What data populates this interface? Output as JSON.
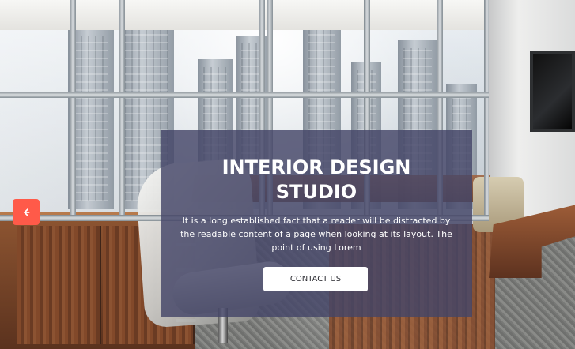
{
  "hero": {
    "headline_line1": "INTERIOR DESIGN",
    "headline_line2": "STUDIO",
    "description": "It is a long established fact that a reader will be distracted by the readable content of a page when looking at its layout. The point of using Lorem",
    "button_label": "CONTACT US"
  },
  "carousel": {
    "previous_icon": "arrow-left-icon"
  },
  "colors": {
    "overlay": "#444668",
    "button_background": "#ffffff",
    "previous_button": "#ff5a49",
    "text": "#ffffff"
  }
}
